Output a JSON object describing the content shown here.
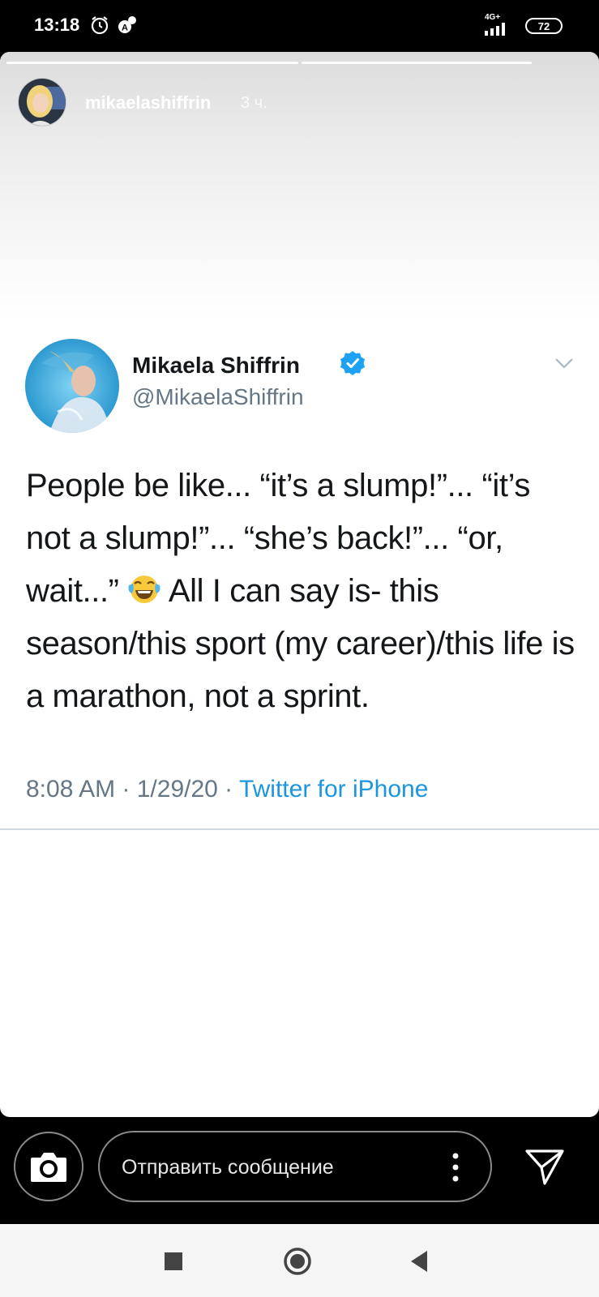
{
  "status_bar": {
    "time": "13:18",
    "network": "4G+",
    "battery": "72",
    "icons": [
      "alarm-icon",
      "auto-brightness-icon",
      "signal-icon",
      "battery-icon"
    ]
  },
  "story": {
    "username": "mikaelashiffrin",
    "time_ago": "3 ч."
  },
  "tweet": {
    "name": "Mikaela Shiffrin",
    "handle": "@MikaelaShiffrin",
    "text_part1": "People be like... “it’s a slump!”... “it’s not a slump!”... “she’s back!”... “or, wait...” ",
    "emoji": "face-with-tears-of-joy-emoji",
    "text_part2": " All I can say is- this season/this sport (my career)/this life is a marathon, not a sprint.",
    "time": "8:08 AM",
    "separator": " · ",
    "date": "1/29/20",
    "source": "Twitter for iPhone",
    "accent_color": "#1b95e0"
  },
  "reply_bar": {
    "placeholder": "Отправить сообщение"
  },
  "nav_bar": {
    "buttons": [
      "recents-icon",
      "home-icon",
      "back-icon"
    ]
  }
}
